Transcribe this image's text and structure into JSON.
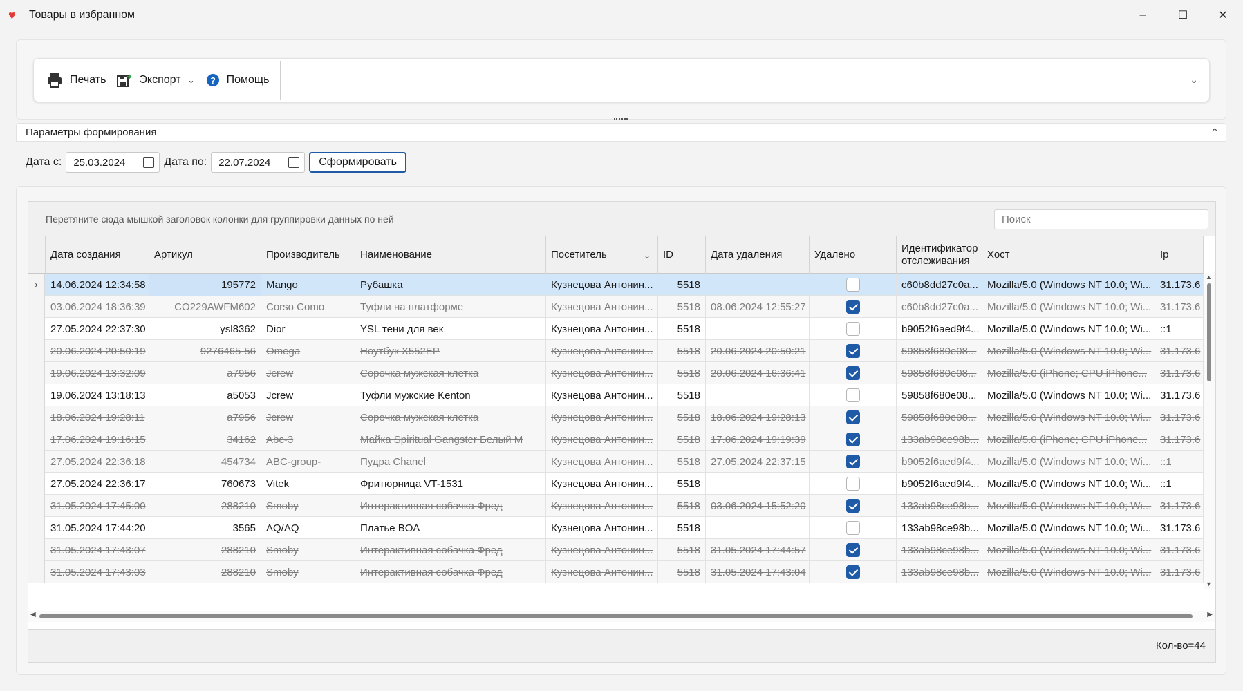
{
  "window": {
    "title": "Товары в избранном",
    "controls": [
      "–",
      "☐",
      "✕"
    ]
  },
  "toolbar": {
    "print_label": "Печать",
    "export_label": "Экспорт",
    "help_label": "Помощь"
  },
  "params": {
    "section_title": "Параметры формирования",
    "date_from_label": "Дата с:",
    "date_from": "25.03.2024",
    "date_to_label": "Дата по:",
    "date_to": "22.07.2024",
    "generate_label": "Сформировать"
  },
  "grid": {
    "group_hint": "Перетяните сюда мышкой заголовок колонки для группировки данных по ней",
    "search_placeholder": "Поиск",
    "columns": [
      "Дата создания",
      "Артикул",
      "Производитель",
      "Наименование",
      "Посетитель",
      "ID",
      "Дата удаления",
      "Удалено",
      "Идентификатор отслеживания",
      "Хост",
      "Ip"
    ],
    "rows": [
      {
        "created": "14.06.2024 12:34:58",
        "sku": "195772",
        "maker": "Mango",
        "name": "Рубашка",
        "visitor": "Кузнецова Антонин...",
        "id": "5518",
        "deleted_at": "",
        "deleted": false,
        "tracking": "c60b8dd27c0a...",
        "host": "Mozilla/5.0 (Windows NT 10.0; Wi...",
        "ip": "31.173.6"
      },
      {
        "created": "03.06.2024 18:36:39",
        "sku": "CO229AWFM602",
        "maker": "Corso Como",
        "name": "Туфли на платформе",
        "visitor": "Кузнецова Антонин...",
        "id": "5518",
        "deleted_at": "08.06.2024 12:55:27",
        "deleted": true,
        "tracking": "c60b8dd27c0a...",
        "host": "Mozilla/5.0 (Windows NT 10.0; Wi...",
        "ip": "31.173.6"
      },
      {
        "created": "27.05.2024 22:37:30",
        "sku": "ysl8362",
        "maker": "Dior",
        "name": "YSL тени для век",
        "visitor": "Кузнецова Антонин...",
        "id": "5518",
        "deleted_at": "",
        "deleted": false,
        "tracking": "b9052f6aed9f4...",
        "host": "Mozilla/5.0 (Windows NT 10.0; Wi...",
        "ip": "::1"
      },
      {
        "created": "20.06.2024 20:50:19",
        "sku": "9276465-56",
        "maker": "Omega",
        "name": "Ноутбук X552EP",
        "visitor": "Кузнецова Антонин...",
        "id": "5518",
        "deleted_at": "20.06.2024 20:50:21",
        "deleted": true,
        "tracking": "59858f680e08...",
        "host": "Mozilla/5.0 (Windows NT 10.0; Wi...",
        "ip": "31.173.6"
      },
      {
        "created": "19.06.2024 13:32:09",
        "sku": "a7956",
        "maker": "Jcrew",
        "name": "Сорочка мужская клетка",
        "visitor": "Кузнецова Антонин...",
        "id": "5518",
        "deleted_at": "20.06.2024 16:36:41",
        "deleted": true,
        "tracking": "59858f680e08...",
        "host": "Mozilla/5.0 (iPhone; CPU iPhone...",
        "ip": "31.173.6"
      },
      {
        "created": "19.06.2024 13:18:13",
        "sku": "a5053",
        "maker": "Jcrew",
        "name": "Туфли мужские Kenton",
        "visitor": "Кузнецова Антонин...",
        "id": "5518",
        "deleted_at": "",
        "deleted": false,
        "tracking": "59858f680e08...",
        "host": "Mozilla/5.0 (Windows NT 10.0; Wi...",
        "ip": "31.173.6"
      },
      {
        "created": "18.06.2024 19:28:11",
        "sku": "a7956",
        "maker": "Jcrew",
        "name": "Сорочка мужская клетка",
        "visitor": "Кузнецова Антонин...",
        "id": "5518",
        "deleted_at": "18.06.2024 19:28:13",
        "deleted": true,
        "tracking": "59858f680e08...",
        "host": "Mozilla/5.0 (Windows NT 10.0; Wi...",
        "ip": "31.173.6"
      },
      {
        "created": "17.06.2024 19:16:15",
        "sku": "34162",
        "maker": "Abc-3",
        "name": "Майка Spiritual Gangster Белый M",
        "visitor": "Кузнецова Антонин...",
        "id": "5518",
        "deleted_at": "17.06.2024 19:19:39",
        "deleted": true,
        "tracking": "133ab98ce98b...",
        "host": "Mozilla/5.0 (iPhone; CPU iPhone...",
        "ip": "31.173.6"
      },
      {
        "created": "27.05.2024 22:36:18",
        "sku": "454734",
        "maker": "ABC-group-",
        "name": "Пудра Chanel",
        "visitor": "Кузнецова Антонин...",
        "id": "5518",
        "deleted_at": "27.05.2024 22:37:15",
        "deleted": true,
        "tracking": "b9052f6aed9f4...",
        "host": "Mozilla/5.0 (Windows NT 10.0; Wi...",
        "ip": "::1"
      },
      {
        "created": "27.05.2024 22:36:17",
        "sku": "760673",
        "maker": "Vitek",
        "name": "Фритюрница VT-1531",
        "visitor": "Кузнецова Антонин...",
        "id": "5518",
        "deleted_at": "",
        "deleted": false,
        "tracking": "b9052f6aed9f4...",
        "host": "Mozilla/5.0 (Windows NT 10.0; Wi...",
        "ip": "::1"
      },
      {
        "created": "31.05.2024 17:45:00",
        "sku": "288210",
        "maker": "Smoby",
        "name": "Интерактивная собачка Фред",
        "visitor": "Кузнецова Антонин...",
        "id": "5518",
        "deleted_at": "03.06.2024 15:52:20",
        "deleted": true,
        "tracking": "133ab98ce98b...",
        "host": "Mozilla/5.0 (Windows NT 10.0; Wi...",
        "ip": "31.173.6"
      },
      {
        "created": "31.05.2024 17:44:20",
        "sku": "3565",
        "maker": "AQ/AQ",
        "name": "Платье BOA",
        "visitor": "Кузнецова Антонин...",
        "id": "5518",
        "deleted_at": "",
        "deleted": false,
        "tracking": "133ab98ce98b...",
        "host": "Mozilla/5.0 (Windows NT 10.0; Wi...",
        "ip": "31.173.6"
      },
      {
        "created": "31.05.2024 17:43:07",
        "sku": "288210",
        "maker": "Smoby",
        "name": "Интерактивная собачка Фред",
        "visitor": "Кузнецова Антонин...",
        "id": "5518",
        "deleted_at": "31.05.2024 17:44:57",
        "deleted": true,
        "tracking": "133ab98ce98b...",
        "host": "Mozilla/5.0 (Windows NT 10.0; Wi...",
        "ip": "31.173.6"
      },
      {
        "created": "31.05.2024 17:43:03",
        "sku": "288210",
        "maker": "Smoby",
        "name": "Интерактивная собачка Фред",
        "visitor": "Кузнецова Антонин...",
        "id": "5518",
        "deleted_at": "31.05.2024 17:43:04",
        "deleted": true,
        "tracking": "133ab98ce98b...",
        "host": "Mozilla/5.0 (Windows NT 10.0; Wi...",
        "ip": "31.173.6"
      }
    ],
    "count_label": "Кол-во=44"
  },
  "colors": {
    "accent": "#1f5aa6",
    "selected_row": "#d2e6fa",
    "app_icon": "#e53935"
  }
}
